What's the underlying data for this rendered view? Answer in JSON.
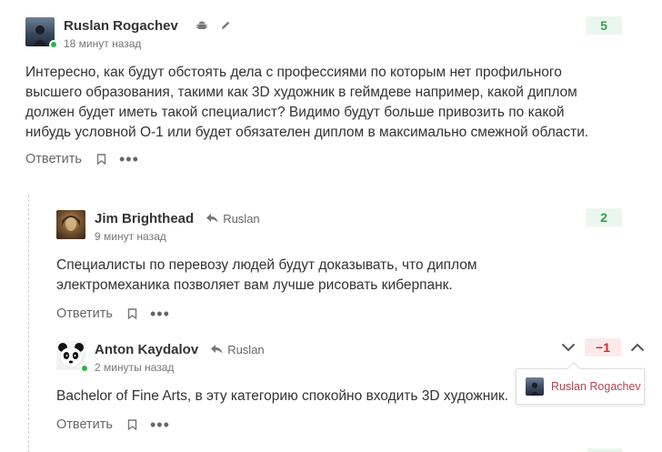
{
  "comments": [
    {
      "author": "Ruslan Rogachev",
      "time": "18 минут назад",
      "text": "Интересно, как будут обстоять дела с профессиями по которым нет профильного высшего образования, такими как 3D художник в геймдеве например, какой диплом должен будет иметь такой специалист? Видимо будут больше привозить по какой нибудь условной О-1 или будет обязателен диплом в максимально смежной области.",
      "score": "5",
      "reply_label": "Ответить",
      "meta_icons": [
        "android-icon",
        "pencil-icon"
      ]
    },
    {
      "author": "Jim Brighthead",
      "time": "9 минут назад",
      "reply_to": "Ruslan",
      "text": "Специалисты по перевозу людей будут доказывать, что диплом электромеханика позволяет вам лучше рисовать киберпанк.",
      "score": "2",
      "reply_label": "Ответить"
    },
    {
      "author": "Anton Kaydalov",
      "time": "2 минуты назад",
      "reply_to": "Ruslan",
      "text": "Bachelor of Fine Arts, в эту категорию спокойно входить 3D художник.",
      "score": "−1",
      "reply_label": "Ответить"
    }
  ],
  "tooltip": {
    "name": "Ruslan Rogachev"
  },
  "colors": {
    "positive_score_bg": "#ebf7ee",
    "positive_score_text": "#2fa249",
    "negative_score_bg": "#fbeaea",
    "negative_score_text": "#cd2e2e",
    "online": "#2fb14d",
    "tooltip_name": "#b8434c"
  }
}
